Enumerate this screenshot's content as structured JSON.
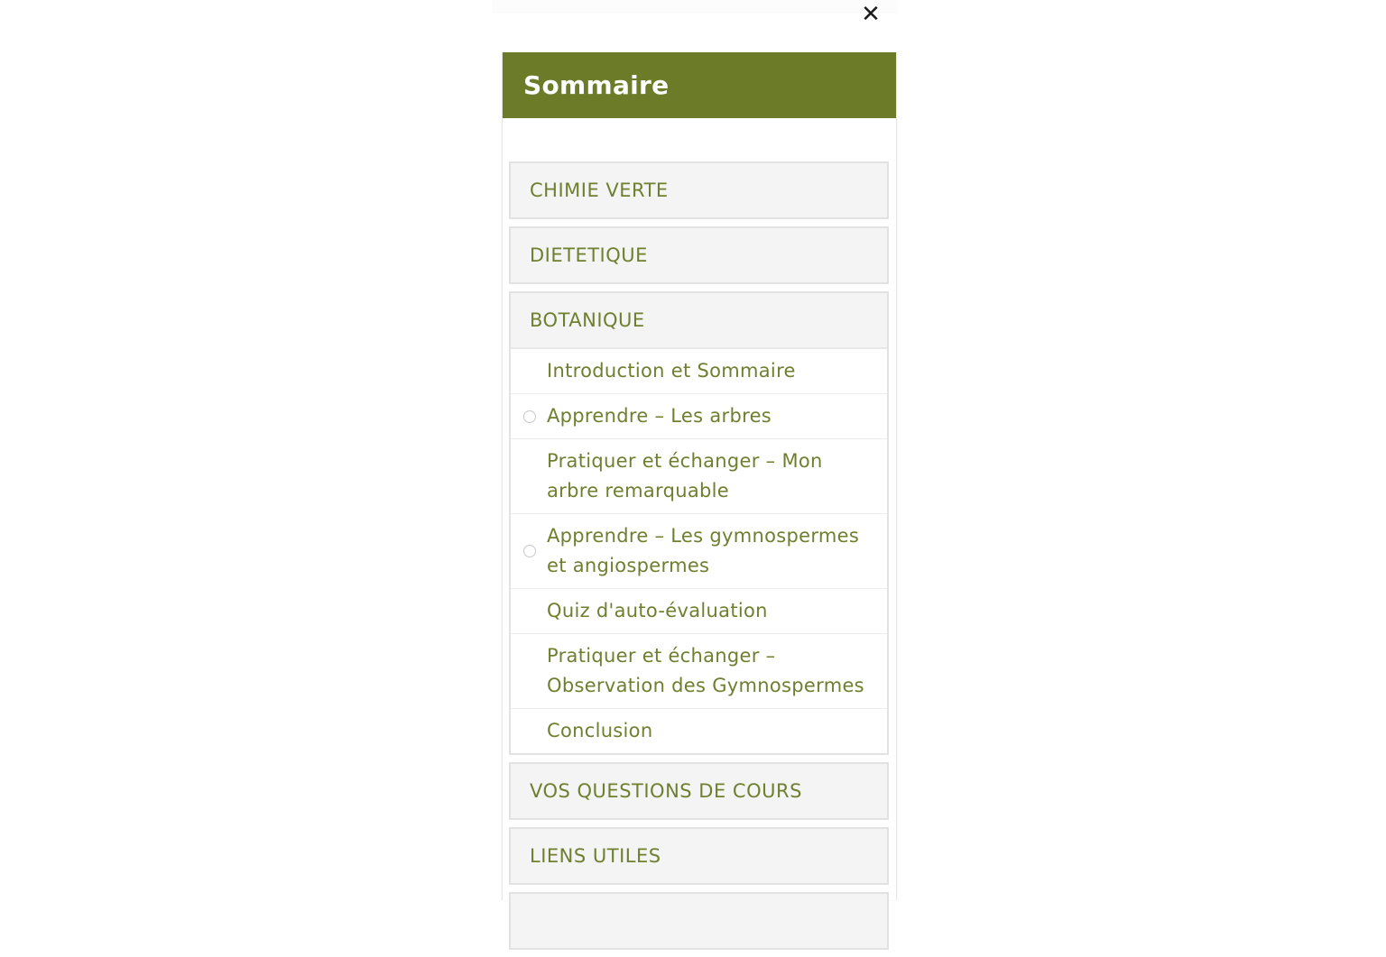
{
  "close_label": "✕",
  "panel": {
    "title": "Sommaire",
    "accent_color": "#6b7b27",
    "link_color": "#6e8030"
  },
  "sections": [
    {
      "label": "CHIMIE VERTE",
      "expanded": false
    },
    {
      "label": "DIETETIQUE",
      "expanded": false
    },
    {
      "label": "BOTANIQUE",
      "expanded": true,
      "items": [
        {
          "label": "Introduction et Sommaire",
          "has_status": false
        },
        {
          "label": "Apprendre – Les arbres",
          "has_status": true
        },
        {
          "label": "Pratiquer et échanger – Mon arbre remarquable",
          "has_status": false
        },
        {
          "label": "Apprendre – Les gymnospermes et angiospermes",
          "has_status": true
        },
        {
          "label": "Quiz d'auto-évaluation",
          "has_status": false
        },
        {
          "label": "Pratiquer et échanger – Observation des Gymnospermes",
          "has_status": false
        },
        {
          "label": "Conclusion",
          "has_status": false
        }
      ]
    },
    {
      "label": "VOS QUESTIONS DE COURS",
      "expanded": false
    },
    {
      "label": "LIENS UTILES",
      "expanded": false
    },
    {
      "label": "",
      "expanded": false
    }
  ]
}
